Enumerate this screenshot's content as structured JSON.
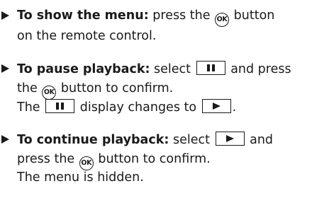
{
  "items": [
    {
      "heading": "To show the menu:",
      "text_a": "press the",
      "text_b": "button",
      "line2": "on the remote control."
    },
    {
      "heading": "To pause playback:",
      "text_a": "select",
      "text_b": "and press",
      "line2_a": "the",
      "line2_b": "button to confirm.",
      "line3_a": "The",
      "line3_b": "display changes to",
      "line3_c": "."
    },
    {
      "heading": "To continue playback:",
      "text_a": "select",
      "text_b": "and",
      "line2_a": "press the",
      "line2_b": "button to confirm.",
      "line3": "The menu is hidden."
    }
  ],
  "icons": {
    "ok_label": "OK",
    "arrow_icon": "triangle-right-bullet-icon",
    "pause_icon": "pause-icon",
    "play_icon": "play-icon"
  },
  "colors": {
    "text": "#1a1a1a",
    "background": "#ffffff"
  }
}
